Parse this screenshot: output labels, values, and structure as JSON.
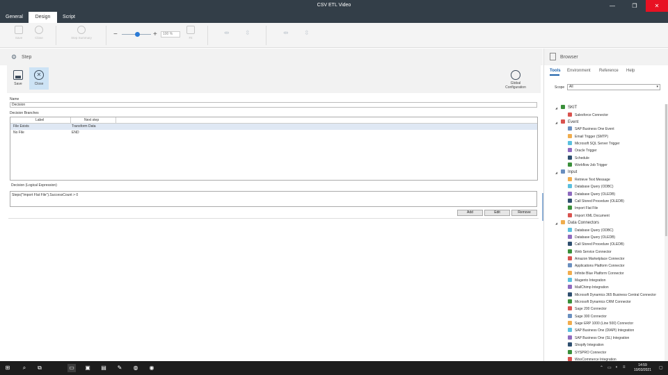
{
  "window": {
    "title": "CSV ETL Video",
    "minimize": "—",
    "maximize": "❐",
    "close": "✕"
  },
  "menu_tabs": [
    "General",
    "Design",
    "Script"
  ],
  "ribbon": {
    "save": "Save",
    "close": "Close",
    "step_summary": "Step Summary",
    "zoom": "100 %",
    "fit": "Fit"
  },
  "step_panel": {
    "header": "Step",
    "save": "Save",
    "close": "Close",
    "global_config": "Global\nConfiguration",
    "name_label": "Name",
    "name_value": "Decision",
    "branches_label": "Decision Branches",
    "columns": [
      "Label",
      "Next step"
    ],
    "rows": [
      {
        "label": "File Exists",
        "next": "Transform Data"
      },
      {
        "label": "No File",
        "next": "END"
      }
    ],
    "expr_label": "Decision (Logical Expression)",
    "expr_value": "Steps(\"Import Flat File\").SuccessCount > 0",
    "buttons": {
      "add": "Add",
      "edit": "Edit",
      "remove": "Remove"
    }
  },
  "browser": {
    "title": "Browser",
    "tabs": [
      "Tools",
      "Environment",
      "Reference",
      "Help"
    ],
    "scope_label": "Scope",
    "scope_value": "All",
    "tree": [
      {
        "cat": "SKIT",
        "items": [
          "Salesforce Connector"
        ]
      },
      {
        "cat": "Event",
        "items": [
          "SAP Business One Event",
          "Email Trigger (SMTP)",
          "Microsoft SQL Server Trigger",
          "Oracle Trigger",
          "Schedule",
          "Workflow Job Trigger"
        ]
      },
      {
        "cat": "Input",
        "items": [
          "Retrieve Text Message",
          "Database Query (ODBC)",
          "Database Query (OLEDB)",
          "Call Stored Procedure (OLEDB)",
          "Import Flat File",
          "Import XML Document"
        ]
      },
      {
        "cat": "Data Connectors",
        "items": [
          "Database Query (ODBC)",
          "Database Query (OLEDB)",
          "Call Stored Procedure (OLEDB)",
          "Web Service Connector",
          "Amazon Marketplace Connector",
          "Applications Platform Connector",
          "Infinite Blue Platform Connector",
          "Magento Integration",
          "MailChimp Integration",
          "Microsoft Dynamics 365 Business Central Connector",
          "Microsoft Dynamics CRM Connector",
          "Sage 200 Connector",
          "Sage 300 Connector",
          "Sage ERP 1000 (Line 500) Connector",
          "SAP Business One (DIAPI) Integration",
          "SAP Business One (SL) Integration",
          "Shopify Integration",
          "SYSPRO Connector",
          "WooCommerce Integration"
        ]
      }
    ]
  },
  "taskbar": {
    "time": "14:59",
    "date": "10/03/2021"
  },
  "colors": {
    "titlebar": "#333e48",
    "accent": "#1a5fa9",
    "selected": "#cde3f5"
  }
}
